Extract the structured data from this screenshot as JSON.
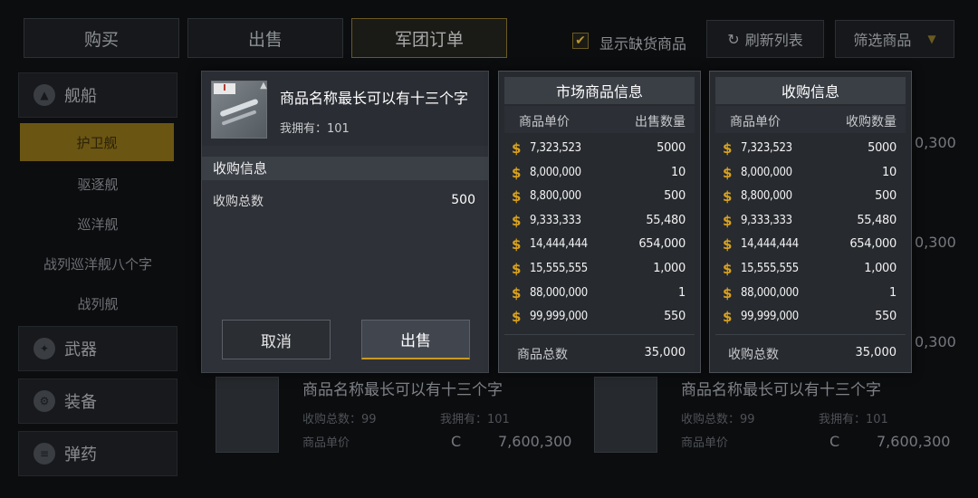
{
  "top_tabs": [
    {
      "label": "购买",
      "active": false
    },
    {
      "label": "出售",
      "active": false
    },
    {
      "label": "军团订单",
      "active": true
    }
  ],
  "top_bar": {
    "show_out_of_stock_label": "显示缺货商品",
    "show_out_of_stock_checked": true,
    "refresh_label": "刷新列表",
    "filter_label": "筛选商品"
  },
  "sidebar": {
    "categories": [
      {
        "label": "舰船",
        "icon": "ship-icon"
      },
      {
        "label": "武器",
        "icon": "weapon-icon"
      },
      {
        "label": "装备",
        "icon": "equipment-icon"
      },
      {
        "label": "弹药",
        "icon": "ammo-icon"
      }
    ],
    "ship_subs": [
      {
        "label": "护卫舰",
        "active": true
      },
      {
        "label": "驱逐舰",
        "active": false
      },
      {
        "label": "巡洋舰",
        "active": false
      },
      {
        "label": "战列巡洋舰八个字",
        "active": false
      },
      {
        "label": "战列舰",
        "active": false
      }
    ]
  },
  "background_list": {
    "right_values": [
      "0,300",
      "0,300",
      "0,300"
    ],
    "cards": [
      {
        "title": "商品名称最长可以有十三个字",
        "total_label": "收购总数：99",
        "own_label": "我拥有：101",
        "price_label": "商品单价",
        "currency": "C",
        "price": "7,600,300"
      },
      {
        "title": "商品名称最长可以有十三个字",
        "total_label": "收购总数：99",
        "own_label": "我拥有：101",
        "price_label": "商品单价",
        "currency": "C",
        "price": "7,600,300"
      }
    ]
  },
  "dialog": {
    "badge": "I",
    "item_name": "商品名称最长可以有十三个字",
    "own_label": "我拥有：101",
    "section_title": "收购信息",
    "total_label": "收购总数",
    "total_value": "500",
    "cancel_label": "取消",
    "sell_label": "出售"
  },
  "market_panel": {
    "title": "市场商品信息",
    "col_price": "商品单价",
    "col_qty": "出售数量",
    "currency_symbol": "$",
    "rows": [
      {
        "price": "7,323,523",
        "qty": "5000"
      },
      {
        "price": "8,000,000",
        "qty": "10"
      },
      {
        "price": "8,800,000",
        "qty": "500"
      },
      {
        "price": "9,333,333",
        "qty": "55,480"
      },
      {
        "price": "14,444,444",
        "qty": "654,000"
      },
      {
        "price": "15,555,555",
        "qty": "1,000"
      },
      {
        "price": "88,000,000",
        "qty": "1"
      },
      {
        "price": "99,999,000",
        "qty": "550"
      }
    ],
    "footer_label": "商品总数",
    "footer_value": "35,000"
  },
  "buy_panel": {
    "title": "收购信息",
    "col_price": "商品单价",
    "col_qty": "收购数量",
    "currency_symbol": "$",
    "rows": [
      {
        "price": "7,323,523",
        "qty": "5000"
      },
      {
        "price": "8,000,000",
        "qty": "10"
      },
      {
        "price": "8,800,000",
        "qty": "500"
      },
      {
        "price": "9,333,333",
        "qty": "55,480"
      },
      {
        "price": "14,444,444",
        "qty": "654,000"
      },
      {
        "price": "15,555,555",
        "qty": "1,000"
      },
      {
        "price": "88,000,000",
        "qty": "1"
      },
      {
        "price": "99,999,000",
        "qty": "550"
      }
    ],
    "footer_label": "收购总数",
    "footer_value": "35,000"
  },
  "colors": {
    "accent_gold": "#d9a21f",
    "dialog_bg": "#2e3137",
    "panel_bg": "#272a2f",
    "active_tab_border": "#6a5a22"
  }
}
